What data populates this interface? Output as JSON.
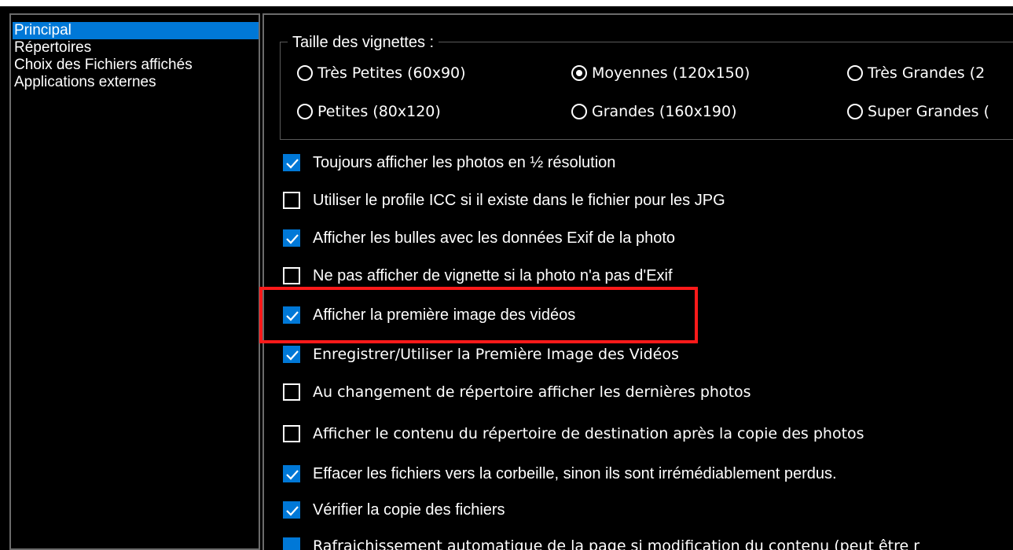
{
  "nav": {
    "items": [
      {
        "label": "Principal",
        "selected": true
      },
      {
        "label": "Répertoires",
        "selected": false
      },
      {
        "label": "Choix des Fichiers affichés",
        "selected": false
      },
      {
        "label": "Applications externes",
        "selected": false
      }
    ]
  },
  "thumbnails": {
    "title": "Taille des vignettes :",
    "options": [
      {
        "label": "Très Petites (60x90)",
        "selected": false
      },
      {
        "label": "Moyennes (120x150)",
        "selected": true
      },
      {
        "label": "Très Grandes (2",
        "selected": false
      },
      {
        "label": "Petites (80x120)",
        "selected": false
      },
      {
        "label": "Grandes (160x190)",
        "selected": false
      },
      {
        "label": "Super Grandes (",
        "selected": false
      }
    ]
  },
  "options": [
    {
      "label": "Toujours afficher les photos en ½ résolution",
      "checked": true
    },
    {
      "label": "Utiliser le profile ICC si il existe dans le fichier pour les JPG",
      "checked": false
    },
    {
      "label": "Afficher les bulles avec les données Exif de la photo",
      "checked": true
    },
    {
      "label": "Ne pas afficher de vignette si la photo n'a pas d'Exif",
      "checked": false
    },
    {
      "label": "Afficher la première image des vidéos",
      "checked": true
    },
    {
      "label": "Enregistrer/Utiliser la Première Image des Vidéos",
      "checked": true
    },
    {
      "label": "Au changement de répertoire afficher les dernières photos",
      "checked": false
    },
    {
      "label": "Afficher le contenu du répertoire de destination après la copie des photos",
      "checked": false
    },
    {
      "label": "Effacer les fichiers vers la corbeille, sinon ils sont irrémédiablement perdus.",
      "checked": true
    },
    {
      "label": "Vérifier la copie des fichiers",
      "checked": true
    },
    {
      "label": "Rafraichissement automatique  de la page si modification du contenu (peut être r",
      "checked": true
    }
  ],
  "colors": {
    "background": "#000000",
    "accent": "#0078d7",
    "highlight": "#ff1a1a",
    "text": "#ffffff"
  }
}
